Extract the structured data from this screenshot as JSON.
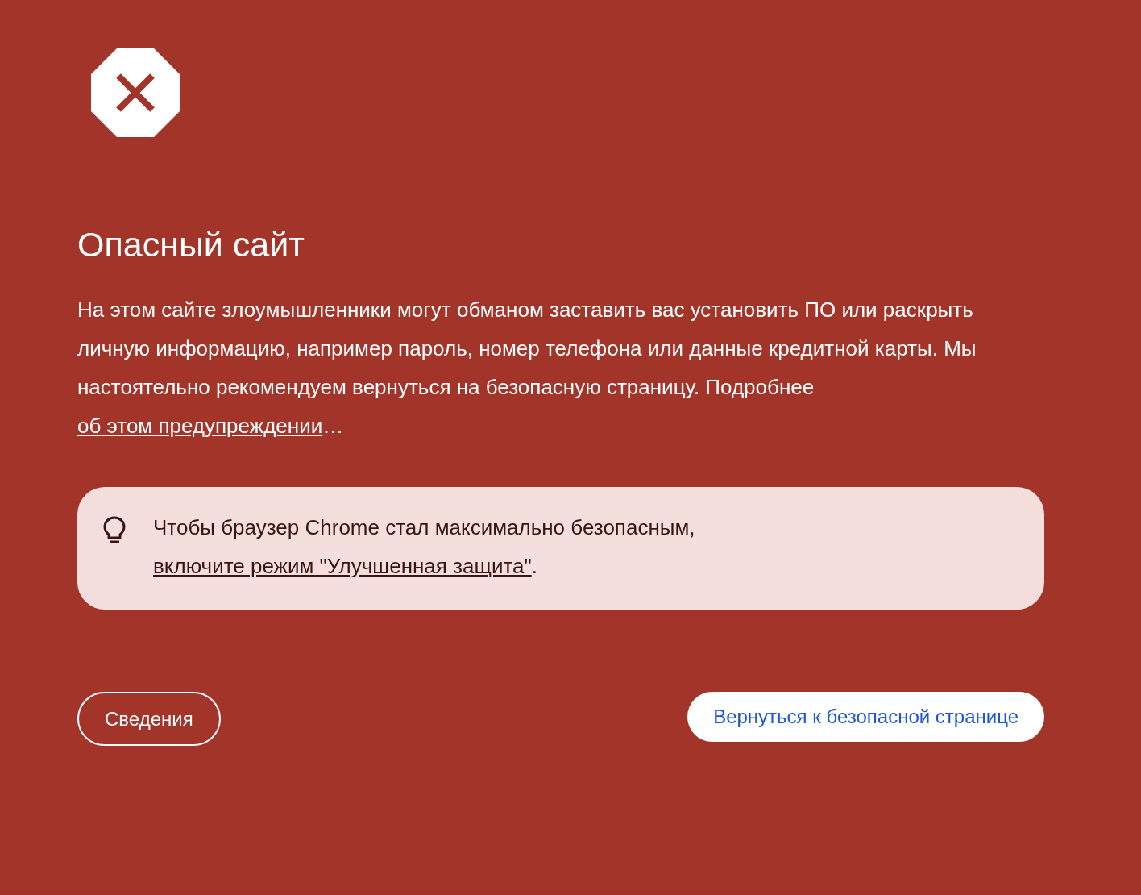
{
  "heading": "Опасный сайт",
  "description": {
    "text": "На этом сайте злоумышленники могут обманом заставить вас установить ПО или раскрыть личную информацию, например пароль, номер телефона или данные кредитной карты. Мы настоятельно рекомендуем вернуться на безопасную страницу. Подробнее ",
    "link": "об этом предупреждении",
    "after": "…"
  },
  "tip": {
    "text": "Чтобы браузер Chrome стал максимально безопасным, ",
    "link": "включите режим \"Улучшенная защита\"",
    "after": "."
  },
  "buttons": [
    {
      "label": "Сведения",
      "kind": "outline"
    },
    {
      "label": "Вернуться к безопасной странице",
      "kind": "primary"
    }
  ]
}
